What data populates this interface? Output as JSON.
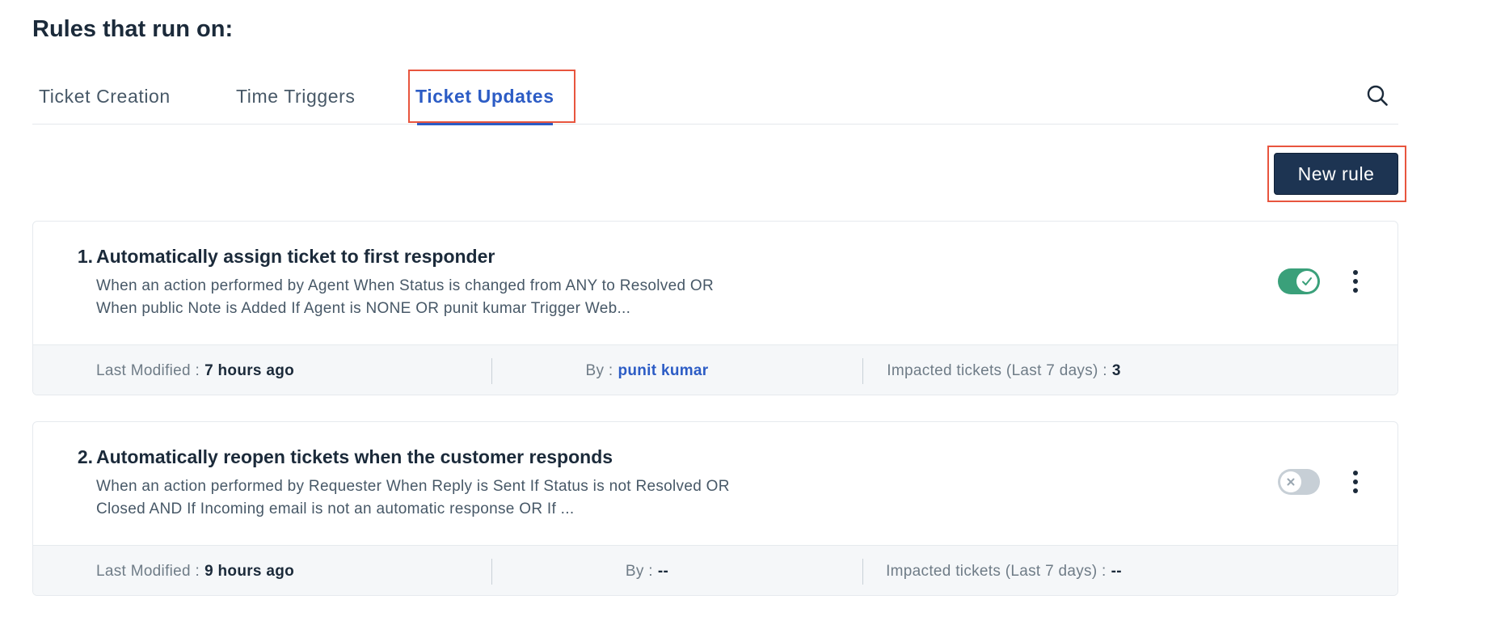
{
  "page": {
    "title": "Rules that run on:"
  },
  "tabs": [
    {
      "label": "Ticket Creation"
    },
    {
      "label": "Time Triggers"
    },
    {
      "label": "Ticket Updates"
    }
  ],
  "toolbar": {
    "new_rule_label": "New rule"
  },
  "icons": {
    "search": "search-icon",
    "more": "more-vertical-icon"
  },
  "colors": {
    "accent": "#2c5cc5",
    "primary_button": "#1d3452",
    "toggle_on": "#3aa07a",
    "toggle_off": "#c7cfd6",
    "highlight": "#e8553e"
  },
  "rules": [
    {
      "number": "1.",
      "title": "Automatically assign ticket to first responder",
      "description_line1": "When an action performed by Agent When Status is changed from ANY to Resolved OR",
      "description_line2": "When public Note is Added If Agent is NONE OR punit kumar Trigger Web...",
      "enabled": true,
      "last_modified_label": "Last Modified :",
      "last_modified_value": "7 hours ago",
      "by_label": "By :",
      "by_value": "punit kumar",
      "impacted_label": "Impacted tickets (Last 7 days) :",
      "impacted_value": "3"
    },
    {
      "number": "2.",
      "title": "Automatically reopen tickets when the customer responds",
      "description_line1": "When an action performed by Requester When Reply is Sent If Status is not Resolved OR",
      "description_line2": "Closed AND If Incoming email is not an automatic response OR If ...",
      "enabled": false,
      "last_modified_label": "Last Modified :",
      "last_modified_value": "9 hours ago",
      "by_label": "By :",
      "by_value": "--",
      "impacted_label": "Impacted tickets (Last 7 days) :",
      "impacted_value": "--"
    }
  ]
}
